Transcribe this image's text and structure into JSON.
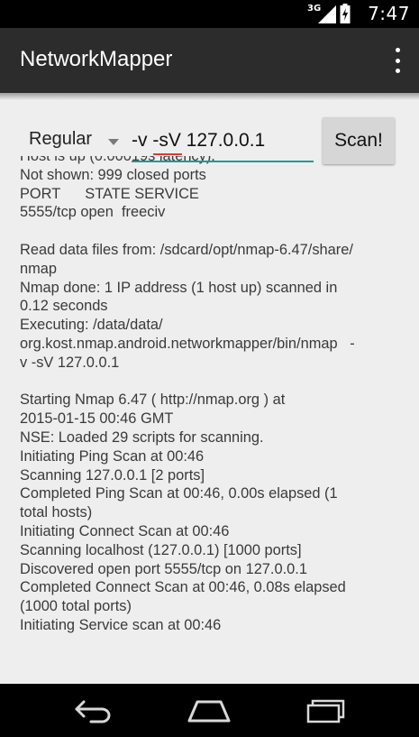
{
  "status_bar": {
    "network_type": "3G",
    "time": "7:47"
  },
  "action_bar": {
    "title": "NetworkMapper",
    "overflow_icon": "more-vert-icon"
  },
  "scan_controls": {
    "profile_selected": "Regular",
    "args_value": "-v -sV 127.0.0.1",
    "scan_label": "Scan!"
  },
  "output": {
    "lines": [
      "Host is up (0.00019s latency).",
      "Not shown: 999 closed ports",
      "PORT      STATE SERVICE",
      "5555/tcp open  freeciv",
      "",
      "Read data files from: /sdcard/opt/nmap-6.47/share/",
      "nmap",
      "Nmap done: 1 IP address (1 host up) scanned in",
      "0.12 seconds",
      "Executing: /data/data/",
      "org.kost.nmap.android.networkmapper/bin/nmap   -",
      "v -sV 127.0.0.1",
      "",
      "Starting Nmap 6.47 ( http://nmap.org ) at",
      "2015-01-15 00:46 GMT",
      "NSE: Loaded 29 scripts for scanning.",
      "Initiating Ping Scan at 00:46",
      "Scanning 127.0.0.1 [2 ports]",
      "Completed Ping Scan at 00:46, 0.00s elapsed (1",
      "total hosts)",
      "Initiating Connect Scan at 00:46",
      "Scanning localhost (127.0.0.1) [1000 ports]",
      "Discovered open port 5555/tcp on 127.0.0.1",
      "Completed Connect Scan at 00:46, 0.08s elapsed",
      "(1000 total ports)",
      "Initiating Service scan at 00:46"
    ]
  },
  "nav_bar": {
    "back_icon": "back-icon",
    "home_icon": "home-icon",
    "recents_icon": "recents-icon"
  },
  "colors": {
    "action_bar": "#2c2c2c",
    "content_bg": "#eeeeee",
    "input_underline": "#1e9c93",
    "spell_error": "#e53935",
    "button_bg": "#d6d6d6"
  }
}
